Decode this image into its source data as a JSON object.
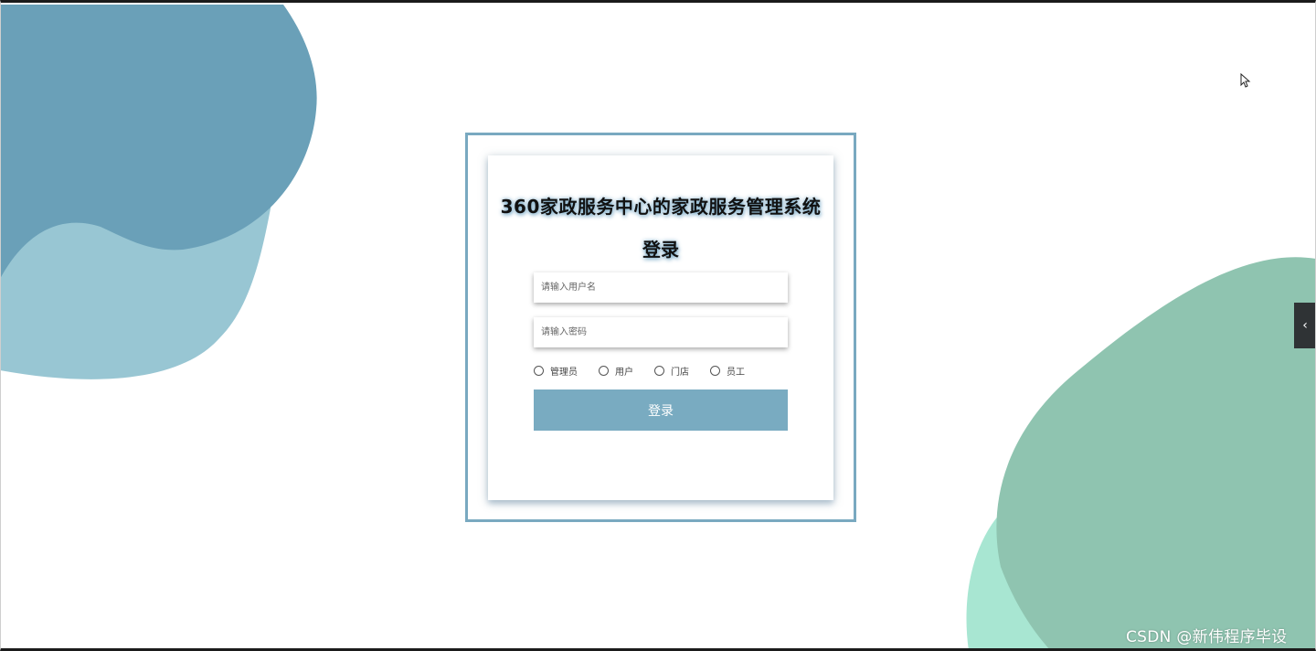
{
  "app": {
    "title": "360家政服务中心的家政服务管理系统",
    "subtitle": "登录"
  },
  "form": {
    "username_placeholder": "请输入用户名",
    "password_placeholder": "请输入密码",
    "roles": [
      "管理员",
      "用户",
      "门店",
      "员工"
    ],
    "login_label": "登录"
  },
  "side_tab": {
    "icon": "chevron-left-icon",
    "glyph": "‹"
  },
  "watermark": "CSDN @新伟程序毕设",
  "colors": {
    "accent": "#79abc1",
    "blob_blue_dark": "#6aa0b8",
    "blob_blue_light": "#98c6d3",
    "blob_green": "#8fc4b0",
    "blob_mint": "#a8e6d2"
  }
}
